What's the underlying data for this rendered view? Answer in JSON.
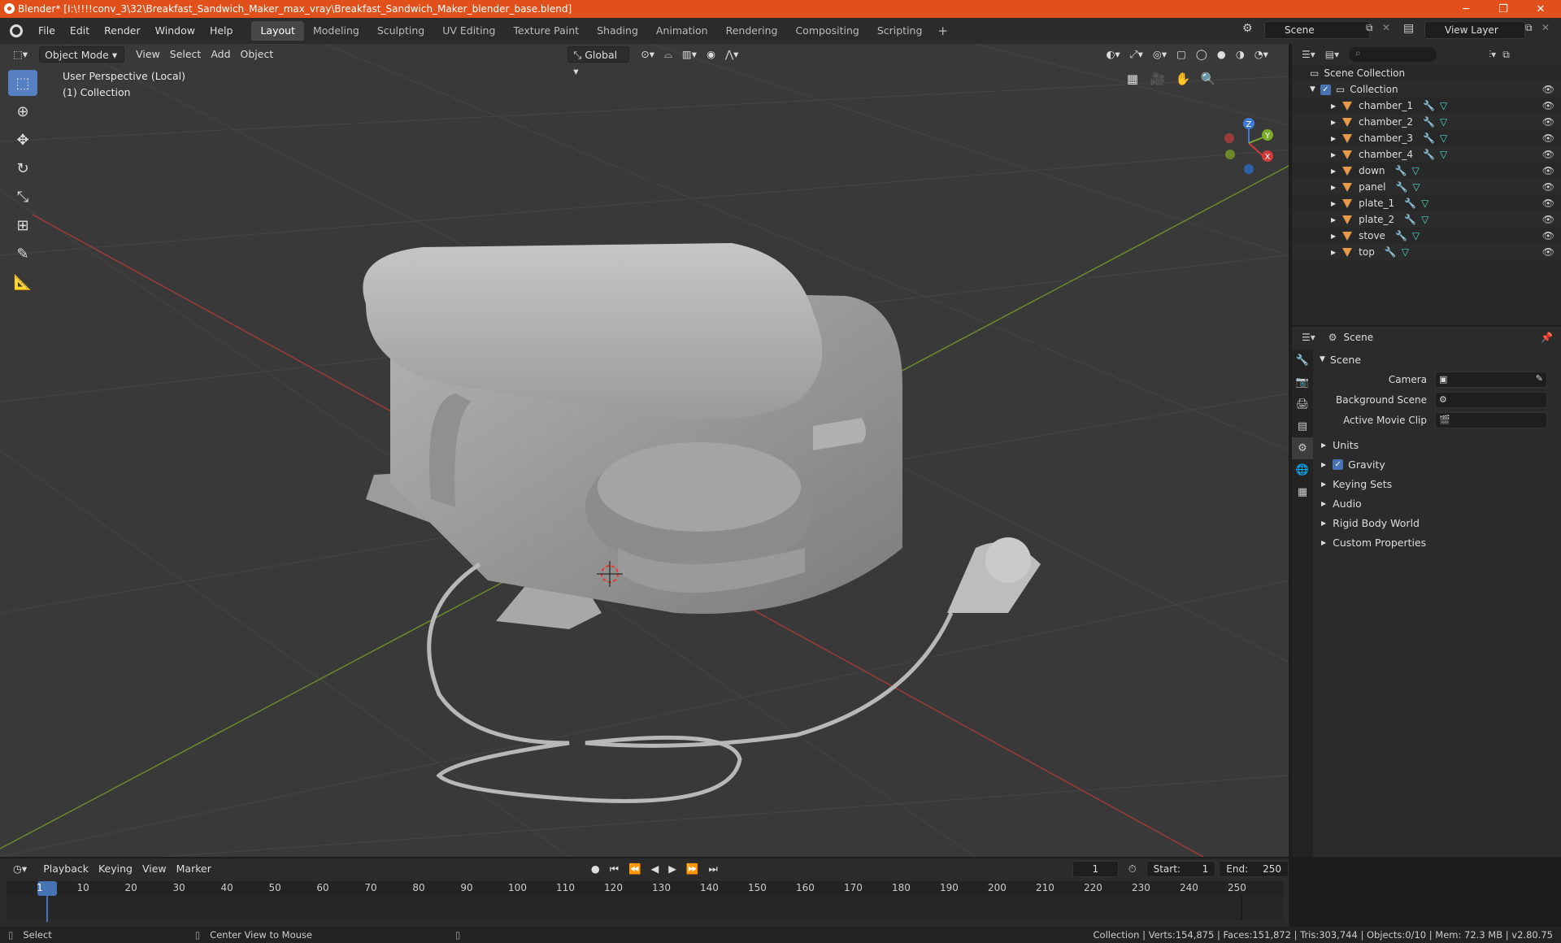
{
  "window": {
    "title": "Blender* [I:\\!!!!conv_3\\32\\Breakfast_Sandwich_Maker_max_vray\\Breakfast_Sandwich_Maker_blender_base.blend]",
    "minimize": "─",
    "maximize": "❐",
    "close": "✕"
  },
  "menu": [
    "File",
    "Edit",
    "Render",
    "Window",
    "Help"
  ],
  "workspaces": [
    "Layout",
    "Modeling",
    "Sculpting",
    "UV Editing",
    "Texture Paint",
    "Shading",
    "Animation",
    "Rendering",
    "Compositing",
    "Scripting"
  ],
  "workspace_add": "+",
  "scene_name": "Scene",
  "view_layer": "View Layer",
  "viewport": {
    "mode": "Object Mode",
    "menus": [
      "View",
      "Select",
      "Add",
      "Object"
    ],
    "transform_orientation": "Global",
    "perspective_label": "User Perspective (Local)",
    "collection_label": "(1) Collection",
    "gizmo": {
      "x": "X",
      "y": "Y",
      "z": "Z"
    }
  },
  "outliner": {
    "root": "Scene Collection",
    "collection": "Collection",
    "objects": [
      "chamber_1",
      "chamber_2",
      "chamber_3",
      "chamber_4",
      "down",
      "panel",
      "plate_1",
      "plate_2",
      "stove",
      "top"
    ]
  },
  "properties": {
    "context": "Scene",
    "panel": "Scene",
    "fields": [
      {
        "label": "Camera",
        "value": ""
      },
      {
        "label": "Background Scene",
        "value": ""
      },
      {
        "label": "Active Movie Clip",
        "value": ""
      }
    ],
    "subpanels": [
      {
        "label": "Units",
        "checkbox": false
      },
      {
        "label": "Gravity",
        "checkbox": true
      },
      {
        "label": "Keying Sets",
        "checkbox": false
      },
      {
        "label": "Audio",
        "checkbox": false
      },
      {
        "label": "Rigid Body World",
        "checkbox": false
      },
      {
        "label": "Custom Properties",
        "checkbox": false
      }
    ]
  },
  "timeline": {
    "menus": [
      "Playback",
      "Keying",
      "View",
      "Marker"
    ],
    "current_frame": "1",
    "start_label": "Start:",
    "start": "1",
    "end_label": "End:",
    "end": "250",
    "ticks": [
      "1",
      "10",
      "20",
      "30",
      "40",
      "50",
      "60",
      "70",
      "80",
      "90",
      "100",
      "110",
      "120",
      "130",
      "140",
      "150",
      "160",
      "170",
      "180",
      "190",
      "200",
      "210",
      "220",
      "230",
      "240",
      "250"
    ]
  },
  "statusbar": {
    "left_action": "Select",
    "middle_action": "Center View to Mouse",
    "stats": "Collection | Verts:154,875 | Faces:151,872 | Tris:303,744 | Objects:0/10 | Mem: 72.3 MB | v2.80.75"
  }
}
